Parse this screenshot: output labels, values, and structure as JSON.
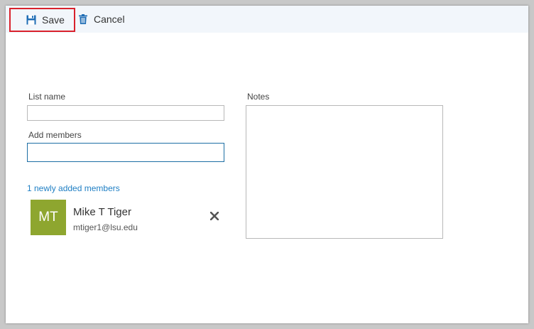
{
  "toolbar": {
    "save_label": "Save",
    "cancel_label": "Cancel",
    "save_icon": "save-icon",
    "cancel_icon": "trash-icon"
  },
  "form": {
    "list_name_label": "List name",
    "list_name_value": "",
    "add_members_label": "Add members",
    "add_members_value": "",
    "notes_label": "Notes",
    "notes_value": ""
  },
  "members": {
    "count_text": "1 newly added members",
    "items": [
      {
        "initials": "MT",
        "name": "Mike T Tiger",
        "email": "mtiger1@lsu.edu",
        "avatar_color": "#8ea62f"
      }
    ]
  },
  "colors": {
    "accent": "#1f7fc4",
    "highlight": "#d9212c",
    "toolbar_bg": "#f2f6fb"
  }
}
